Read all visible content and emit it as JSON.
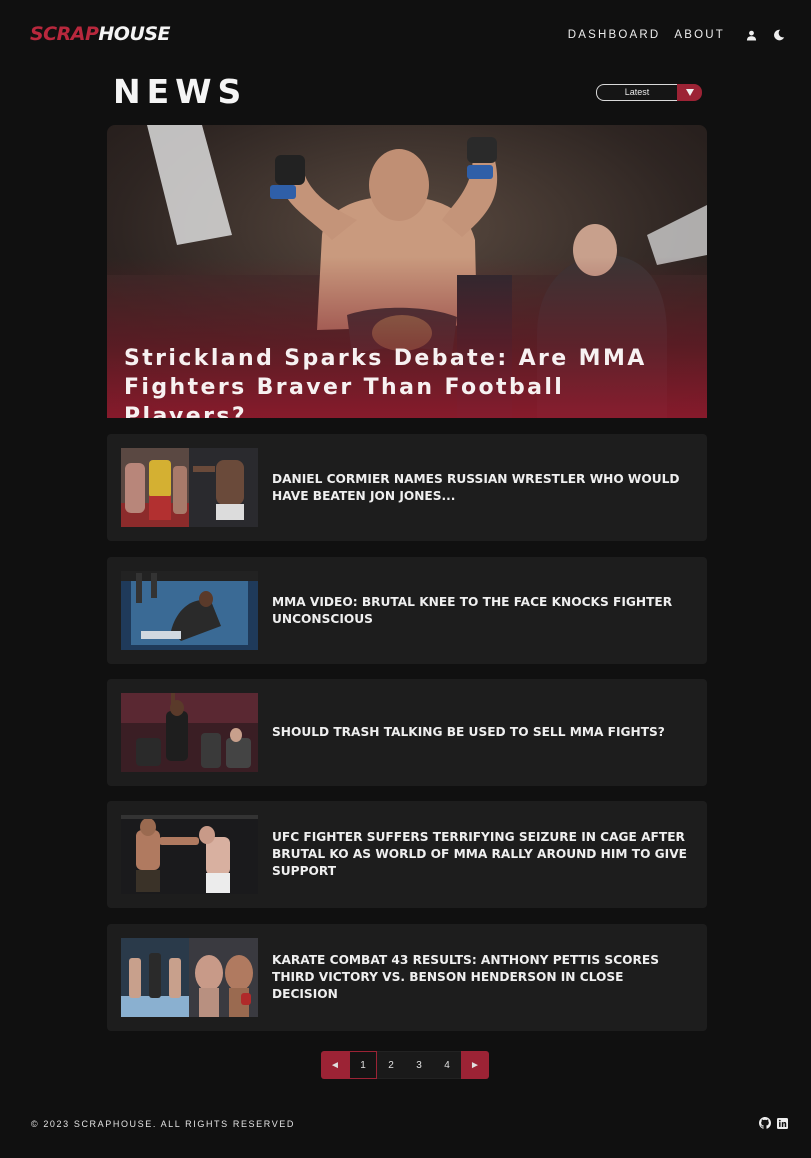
{
  "brand": {
    "part1": "SCRAP",
    "part2": "HOUSE",
    "color_accent": "#b8283d"
  },
  "nav": {
    "links": [
      "DASHBOARD",
      "ABOUT"
    ],
    "icons": [
      "user-icon",
      "moon-icon"
    ]
  },
  "page": {
    "title": "NEWS",
    "sort": {
      "selected": "Latest"
    }
  },
  "hero": {
    "title": "Strickland Sparks Debate: Are MMA Fighters Braver Than Football Players?"
  },
  "articles": [
    {
      "headline": "DANIEL CORMIER NAMES RUSSIAN WRESTLER WHO WOULD HAVE BEATEN JON JONES..."
    },
    {
      "headline": "MMA VIDEO: BRUTAL KNEE TO THE FACE KNOCKS FIGHTER UNCONSCIOUS"
    },
    {
      "headline": "SHOULD TRASH TALKING BE USED TO SELL MMA FIGHTS?"
    },
    {
      "headline": "UFC FIGHTER SUFFERS TERRIFYING SEIZURE IN CAGE AFTER BRUTAL KO AS WORLD OF MMA RALLY AROUND HIM TO GIVE SUPPORT"
    },
    {
      "headline": "KARATE COMBAT 43 RESULTS: ANTHONY PETTIS SCORES THIRD VICTORY VS. BENSON HENDERSON IN CLOSE DECISION"
    }
  ],
  "pagination": {
    "prev": "◄",
    "next": "►",
    "pages": [
      "1",
      "2",
      "3",
      "4"
    ],
    "current": "1"
  },
  "footer": {
    "copyright": "© 2023 SCRAPHOUSE. ALL RIGHTS RESERVED",
    "icons": [
      "github-icon",
      "linkedin-icon"
    ]
  }
}
